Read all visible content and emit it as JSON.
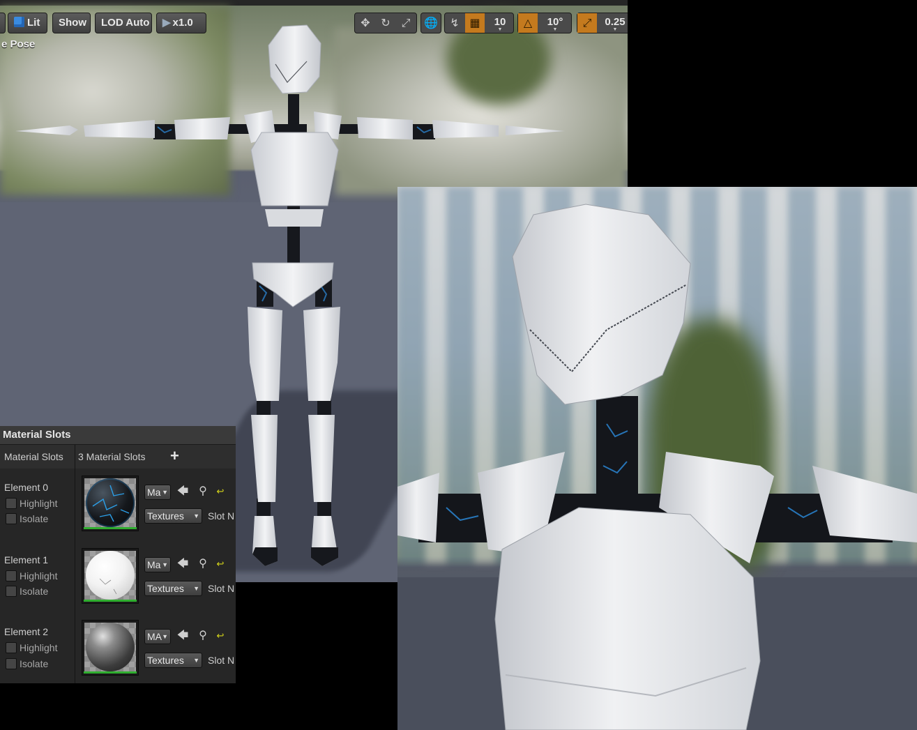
{
  "toolbar": {
    "lit_label": "Lit",
    "show_label": "Show",
    "lod_label": "LOD Auto",
    "speed_label": "x1.0",
    "grid_snap_value": "10",
    "rotation_snap_value": "10°",
    "scale_snap_value": "0.25",
    "accent_color": "#c47a1e"
  },
  "viewport": {
    "pose_label": "e Pose"
  },
  "material_panel": {
    "title": "Material Slots",
    "slots_label": "Material Slots",
    "slots_count": "3 Material Slots",
    "add_icon": "plus-icon",
    "elements": [
      {
        "name": "Element 0",
        "highlight": "Highlight",
        "isolate": "Isolate",
        "material": "Ma",
        "textures": "Textures",
        "slot_name": "Slot N"
      },
      {
        "name": "Element 1",
        "highlight": "Highlight",
        "isolate": "Isolate",
        "material": "Ma",
        "textures": "Textures",
        "slot_name": "Slot N"
      },
      {
        "name": "Element 2",
        "highlight": "Highlight",
        "isolate": "Isolate",
        "material": "MA",
        "textures": "Textures",
        "slot_name": "Slot N"
      }
    ],
    "thumb_bar_color": "#2fae2f"
  }
}
